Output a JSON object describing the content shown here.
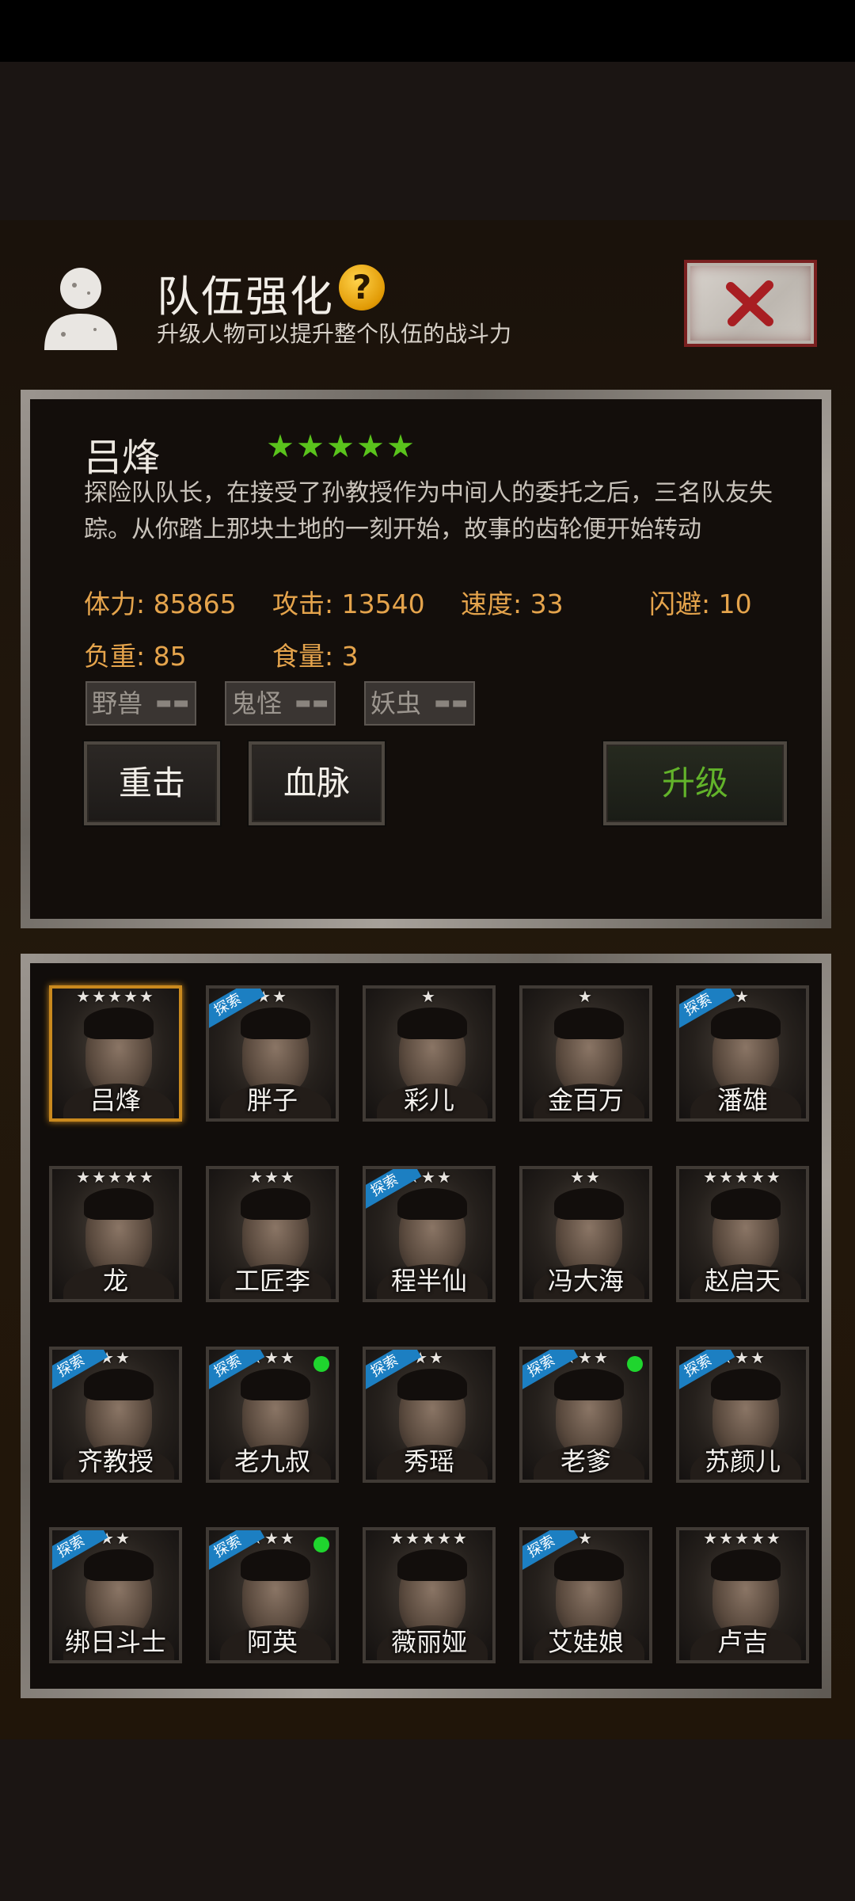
{
  "header": {
    "title": "队伍强化",
    "help_symbol": "?",
    "subtitle": "升级人物可以提升整个队伍的战斗力"
  },
  "selected_character": {
    "name": "吕烽",
    "rating_stars": 5,
    "description": "探险队队长，在接受了孙教授作为中间人的委托之后，三名队友失踪。从你踏上那块土地的一刻开始，故事的齿轮便开始转动",
    "stats": {
      "hp": "体力: 85865",
      "attack": "攻击: 13540",
      "speed": "速度: 33",
      "dodge": "闪避: 10",
      "load": "负重: 85",
      "food": "食量: 3"
    },
    "tags": [
      "野兽",
      "鬼怪",
      "妖虫"
    ],
    "tag_dashes": "▬▬"
  },
  "buttons": {
    "heavy_strike": "重击",
    "bloodline": "血脉",
    "upgrade": "升级"
  },
  "colors": {
    "accent_orange": "#e5a44c",
    "upgrade_green": "#62b32a",
    "star_green": "#5ac31c",
    "explore_blue": "#1c7fc2",
    "status_dot_green": "#1fd52e"
  },
  "explore_label": "探索",
  "roster": [
    {
      "name": "吕烽",
      "stars": "★★★★★",
      "explore": false,
      "dot": false,
      "selected": true
    },
    {
      "name": "胖子",
      "stars": "★★",
      "explore": true,
      "dot": false,
      "selected": false
    },
    {
      "name": "彩儿",
      "stars": "★",
      "explore": false,
      "dot": false,
      "selected": false
    },
    {
      "name": "金百万",
      "stars": "★",
      "explore": false,
      "dot": false,
      "selected": false
    },
    {
      "name": "潘雄",
      "stars": "★",
      "explore": true,
      "dot": false,
      "selected": false
    },
    {
      "name": "龙",
      "stars": "★★★★★",
      "explore": false,
      "dot": false,
      "selected": false
    },
    {
      "name": "工匠李",
      "stars": "★★★",
      "explore": false,
      "dot": false,
      "selected": false
    },
    {
      "name": "程半仙",
      "stars": "★★★",
      "explore": true,
      "dot": false,
      "selected": false
    },
    {
      "name": "冯大海",
      "stars": "★★",
      "explore": false,
      "dot": false,
      "selected": false
    },
    {
      "name": "赵启天",
      "stars": "★★★★★",
      "explore": false,
      "dot": false,
      "selected": false
    },
    {
      "name": "齐教授",
      "stars": "★★",
      "explore": true,
      "dot": false,
      "selected": false
    },
    {
      "name": "老九叔",
      "stars": "★★★",
      "explore": true,
      "dot": true,
      "selected": false
    },
    {
      "name": "秀瑶",
      "stars": "★★",
      "explore": true,
      "dot": false,
      "selected": false
    },
    {
      "name": "老爹",
      "stars": "★★★",
      "explore": true,
      "dot": true,
      "selected": false
    },
    {
      "name": "苏颜儿",
      "stars": "★★★",
      "explore": true,
      "dot": false,
      "selected": false
    },
    {
      "name": "绑日斗士",
      "stars": "★★",
      "explore": true,
      "dot": false,
      "selected": false
    },
    {
      "name": "阿英",
      "stars": "★★★",
      "explore": true,
      "dot": true,
      "selected": false
    },
    {
      "name": "薇丽娅",
      "stars": "★★★★★",
      "explore": false,
      "dot": false,
      "selected": false
    },
    {
      "name": "艾娃娘",
      "stars": "★",
      "explore": true,
      "dot": false,
      "selected": false
    },
    {
      "name": "卢吉",
      "stars": "★★★★★",
      "explore": false,
      "dot": false,
      "selected": false
    }
  ]
}
